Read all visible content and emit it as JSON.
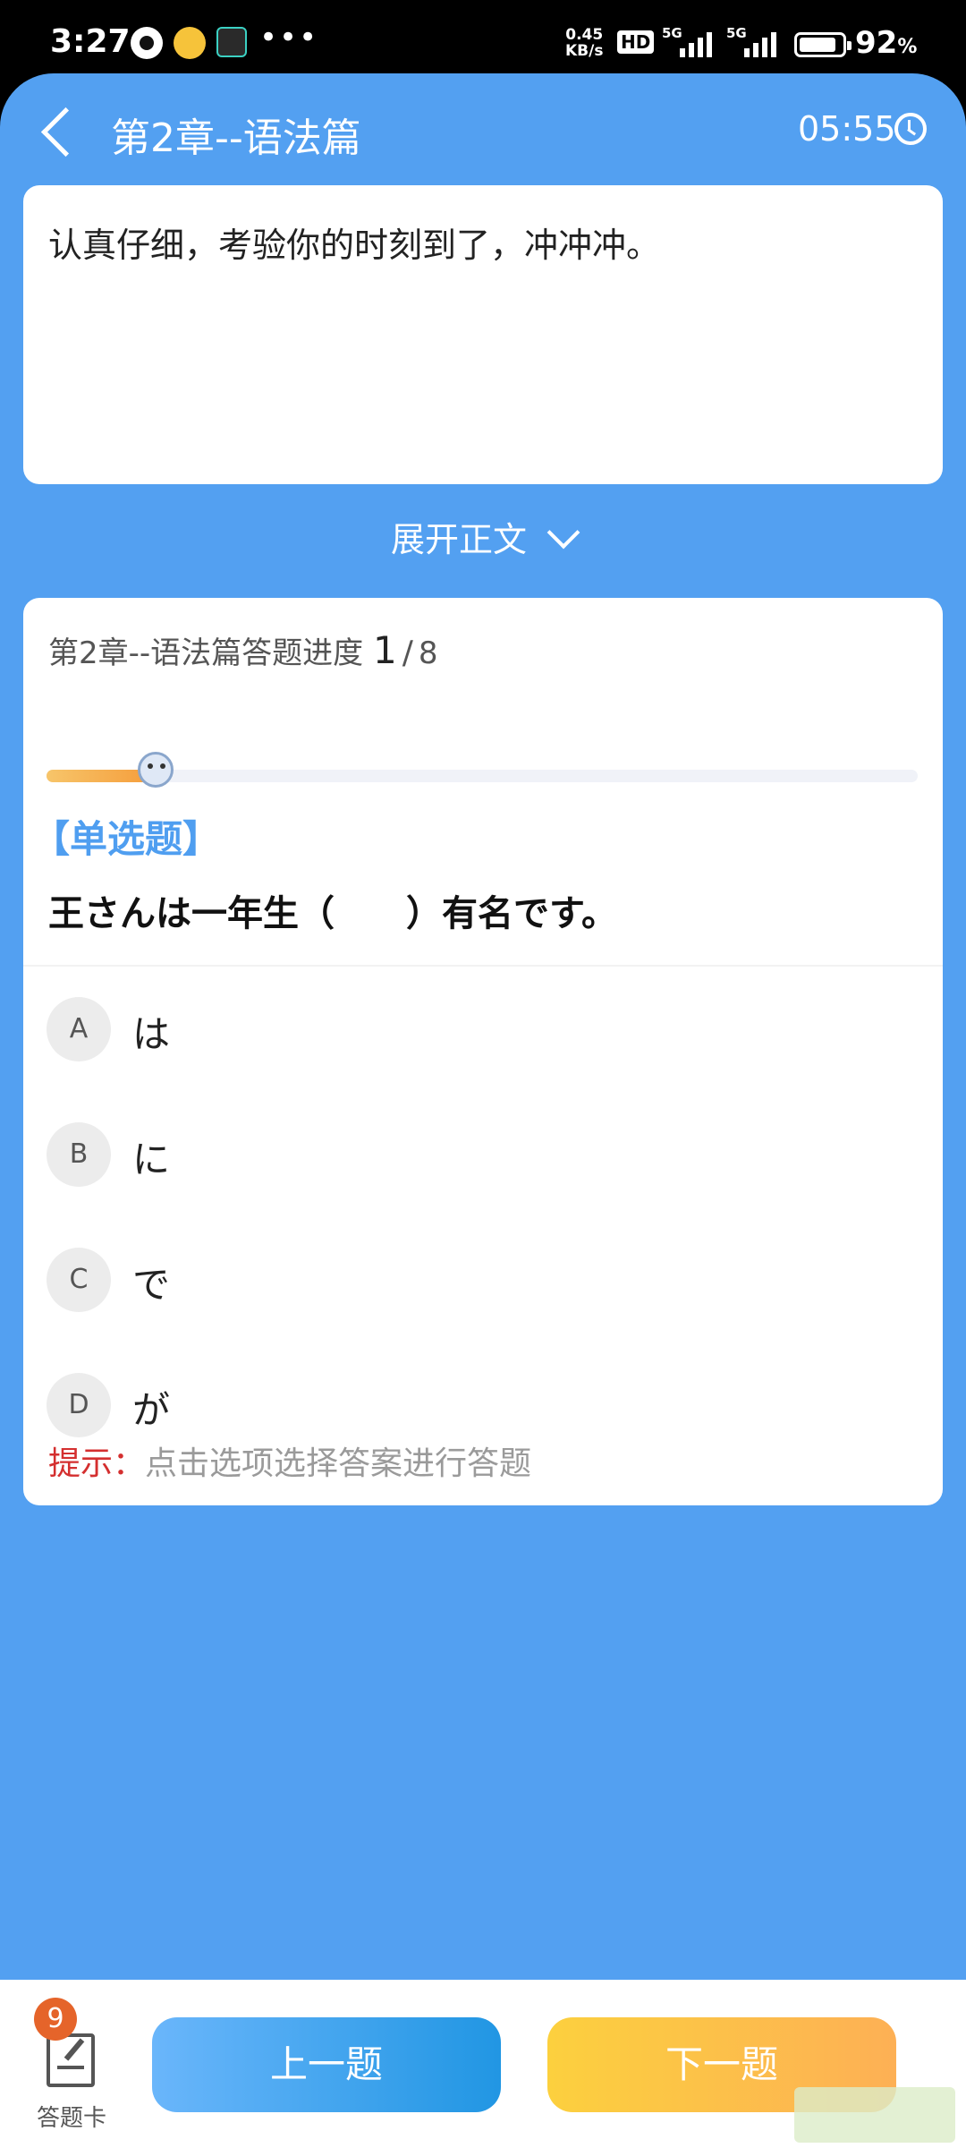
{
  "status_bar": {
    "time": "3:27",
    "net_speed_value": "0.45",
    "net_speed_unit": "KB/s",
    "hd_label": "HD",
    "signal1_label": "5G",
    "signal2_label": "5G",
    "battery_percent": "92",
    "battery_unit": "%"
  },
  "header": {
    "title": "第2章--语法篇",
    "timer": "05:55"
  },
  "passage": {
    "text": "认真仔细，考验你的时刻到了，冲冲冲。"
  },
  "expand": {
    "label": "展开正文"
  },
  "question_card": {
    "progress_prefix": "第2章--语法篇答题进度",
    "progress_current": "1",
    "progress_separator": "/",
    "progress_total": "8",
    "progress_fraction": 0.125,
    "question_type": "【单选题】",
    "question_text": "王さんは一年生（　　）有名です。",
    "options": [
      {
        "letter": "A",
        "text": "は"
      },
      {
        "letter": "B",
        "text": "に"
      },
      {
        "letter": "C",
        "text": "で"
      },
      {
        "letter": "D",
        "text": "が"
      }
    ],
    "hint_label": "提示：",
    "hint_text": "点击选项选择答案进行答题"
  },
  "bottom_bar": {
    "answer_card_badge": "9",
    "answer_card_label": "答题卡",
    "prev_label": "上一题",
    "next_label": "下一题"
  },
  "colors": {
    "primary_blue": "#53a0f1",
    "question_type_blue": "#4f9ef0",
    "hint_red": "#d42f2f",
    "badge_orange": "#e5642a"
  }
}
